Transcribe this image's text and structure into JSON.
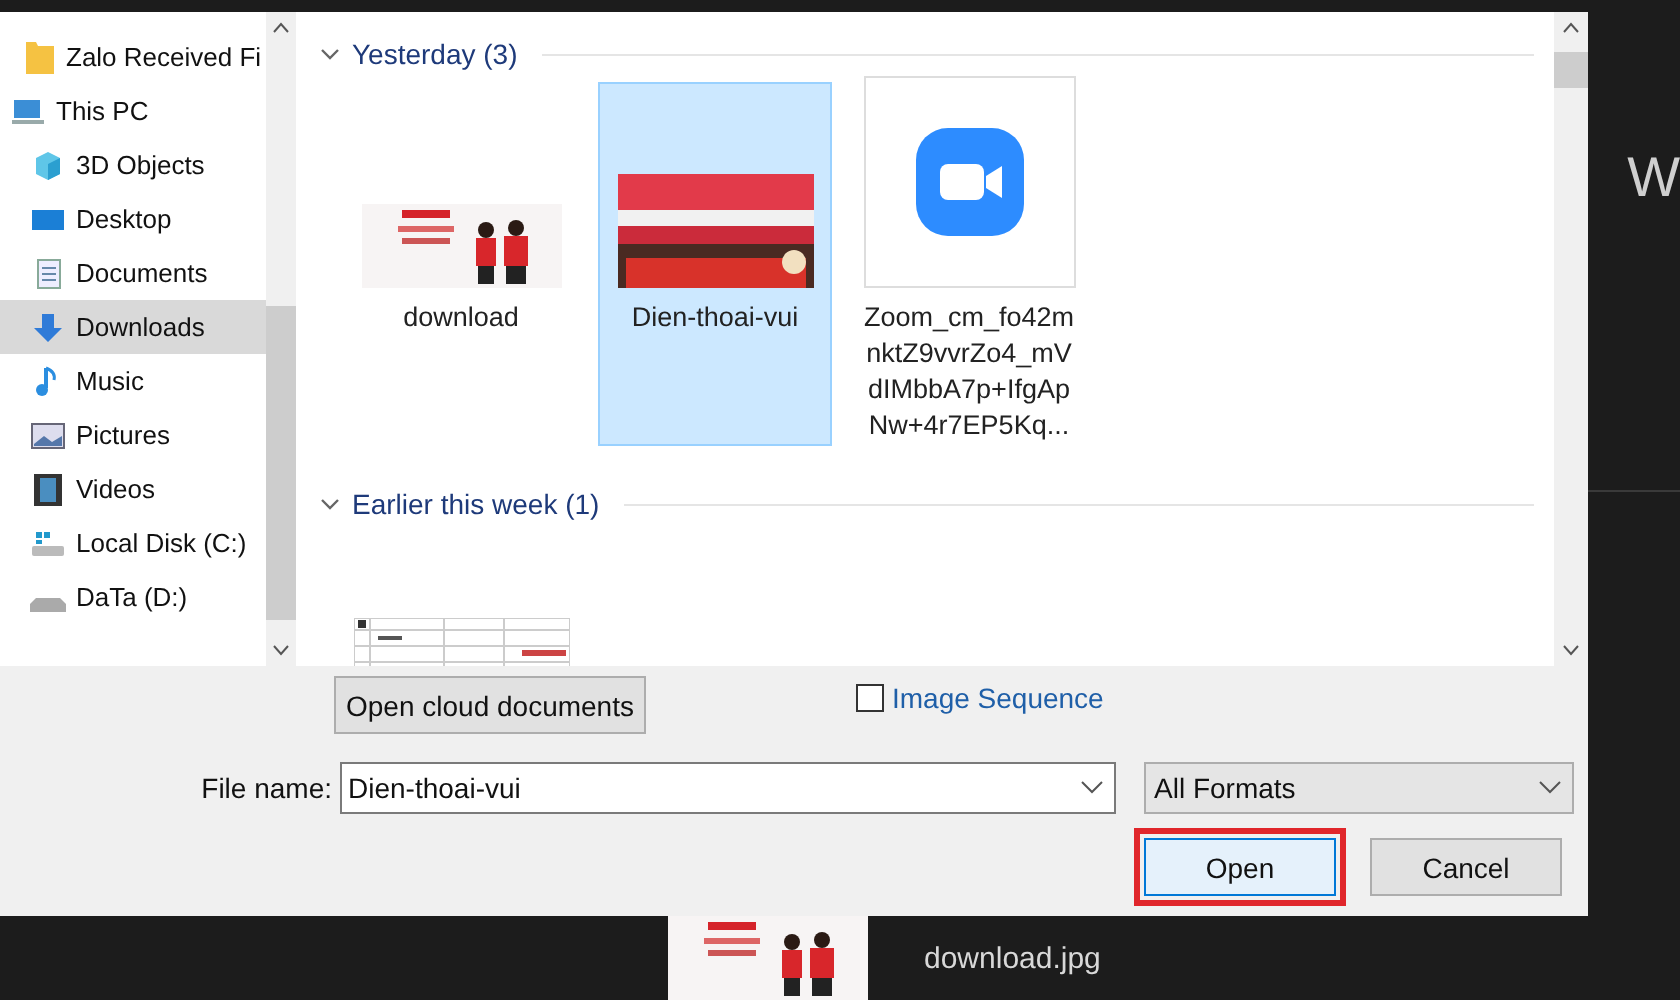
{
  "nav": {
    "items": [
      {
        "label": "Zalo Received Fi",
        "kind": "folder",
        "selected": false
      },
      {
        "label": "This PC",
        "kind": "pc",
        "selected": false,
        "children": [
          {
            "label": "3D Objects",
            "kind": "cube",
            "selected": false
          },
          {
            "label": "Desktop",
            "kind": "desktop",
            "selected": false
          },
          {
            "label": "Documents",
            "kind": "document",
            "selected": false
          },
          {
            "label": "Downloads",
            "kind": "download",
            "selected": true
          },
          {
            "label": "Music",
            "kind": "music",
            "selected": false
          },
          {
            "label": "Pictures",
            "kind": "pictures",
            "selected": false
          },
          {
            "label": "Videos",
            "kind": "video",
            "selected": false
          },
          {
            "label": "Local Disk (C:)",
            "kind": "system-disk",
            "selected": false
          },
          {
            "label": "DaTa (D:)",
            "kind": "drive",
            "selected": false
          }
        ]
      }
    ]
  },
  "groups": [
    {
      "label": "Yesterday (3)",
      "expanded": true,
      "files": [
        {
          "name": "download",
          "kind": "banner",
          "selected": false
        },
        {
          "name": "Dien-thoai-vui",
          "kind": "shop",
          "selected": true
        },
        {
          "name": "Zoom_cm_fo42mnktZ9vvrZo4_mVdIMbbA7p+IfgApNw+4r7EP5Kq...",
          "kind": "video-app",
          "selected": false
        }
      ]
    },
    {
      "label": "Earlier this week (1)",
      "expanded": true,
      "files": [
        {
          "kind": "sheet",
          "selected": false
        }
      ]
    }
  ],
  "cloud_button": "Open cloud documents",
  "image_sequence": {
    "label": "Image Sequence",
    "checked": false
  },
  "file_name": {
    "label": "File name:",
    "value": "Dien-thoai-vui"
  },
  "format": "All Formats",
  "buttons": [
    {
      "label": "Open",
      "default": true,
      "highlighted": true
    },
    {
      "label": "Cancel",
      "default": false,
      "highlighted": false
    }
  ],
  "taskbar": {
    "file": "download.jpg"
  },
  "background_text": "W"
}
